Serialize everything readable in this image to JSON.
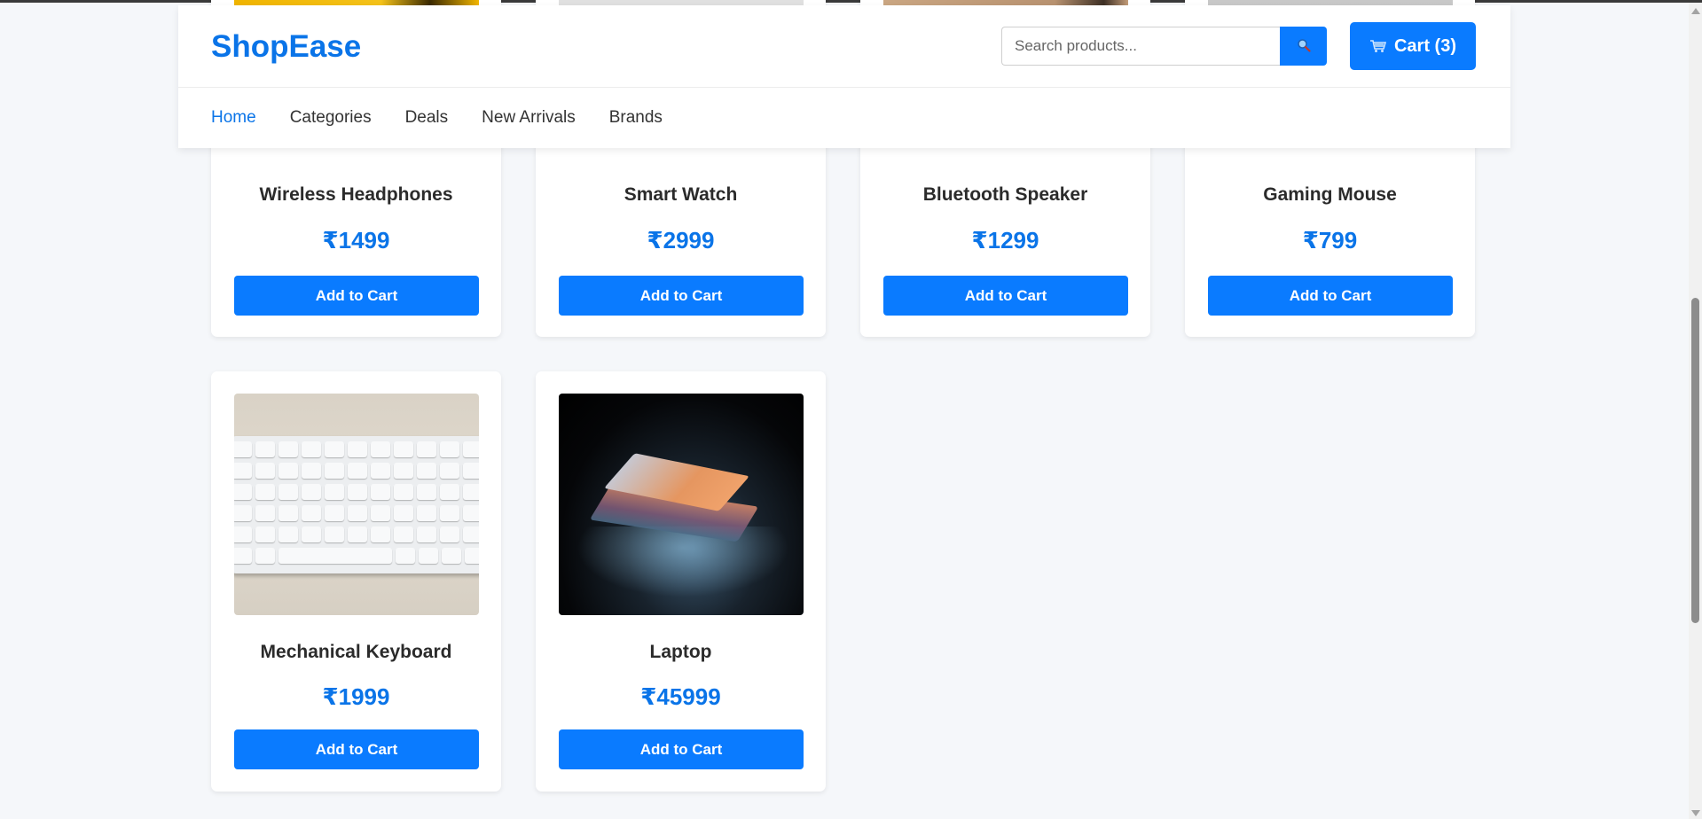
{
  "header": {
    "logo": "ShopEase",
    "search_placeholder": "Search products...",
    "search_icon": "search-icon",
    "cart_icon": "cart-icon",
    "cart_label": "Cart (3)",
    "nav": [
      {
        "label": "Home",
        "active": true
      },
      {
        "label": "Categories",
        "active": false
      },
      {
        "label": "Deals",
        "active": false
      },
      {
        "label": "New Arrivals",
        "active": false
      },
      {
        "label": "Brands",
        "active": false
      }
    ]
  },
  "products": [
    {
      "name": "Wireless Headphones",
      "price": "₹1499",
      "button": "Add to Cart"
    },
    {
      "name": "Smart Watch",
      "price": "₹2999",
      "button": "Add to Cart"
    },
    {
      "name": "Bluetooth Speaker",
      "price": "₹1299",
      "button": "Add to Cart"
    },
    {
      "name": "Gaming Mouse",
      "price": "₹799",
      "button": "Add to Cart"
    },
    {
      "name": "Mechanical Keyboard",
      "price": "₹1999",
      "button": "Add to Cart"
    },
    {
      "name": "Laptop",
      "price": "₹45999",
      "button": "Add to Cart"
    }
  ],
  "colors": {
    "brand": "#0a74e8",
    "button": "#0a7bff",
    "background": "#f5f7fa"
  }
}
